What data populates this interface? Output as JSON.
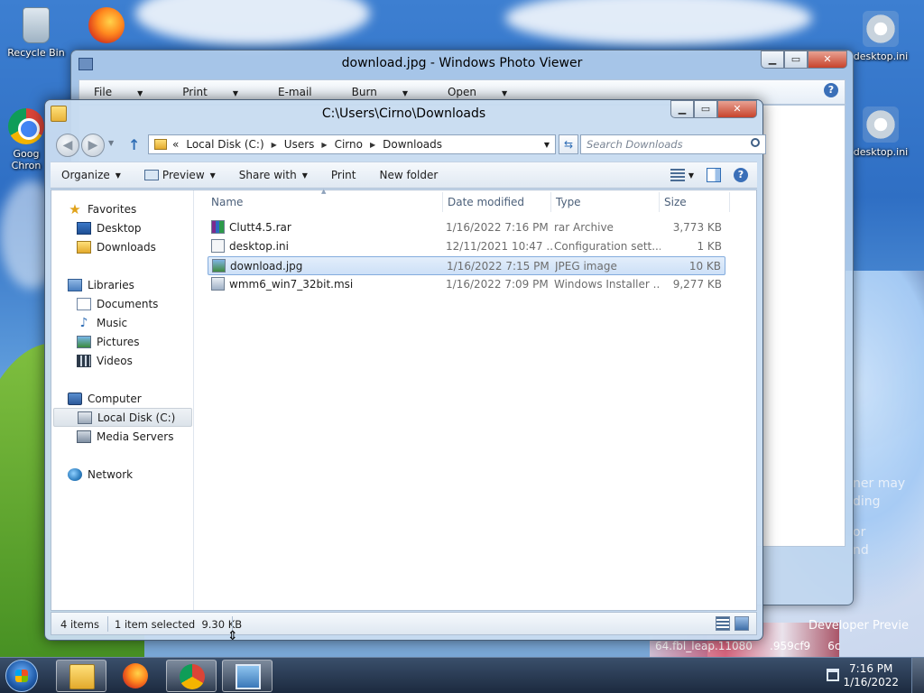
{
  "desktop": {
    "icons": {
      "recycle_bin": "Recycle Bin",
      "chrome_line1": "Goog",
      "chrome_line2": "Chron",
      "desktop_ini_1": "desktop.ini",
      "desktop_ini_2": "desktop.ini"
    },
    "watermark": {
      "line1": "ner may",
      "line2": "ding",
      "line3": "or",
      "line4": "nd",
      "build_name": "Developer Previe",
      "build_string": "64.fbl_leap.11080     .959cf9     6c"
    }
  },
  "photo_viewer": {
    "title": "download.jpg - Windows Photo Viewer",
    "menu": [
      "File",
      "Print",
      "E-mail",
      "Burn",
      "Open"
    ],
    "help": "?"
  },
  "explorer": {
    "title": "C:\\Users\\Cirno\\Downloads",
    "window_buttons": {
      "min": "▁",
      "max": "▭",
      "close": "✕"
    },
    "address": {
      "prefix": "«",
      "crumbs": [
        "Local Disk (C:)",
        "Users",
        "Cirno",
        "Downloads"
      ]
    },
    "search_placeholder": "Search Downloads",
    "toolbar": {
      "organize": "Organize",
      "preview": "Preview",
      "share": "Share with",
      "print": "Print",
      "new_folder": "New folder",
      "help": "?"
    },
    "nav": {
      "favorites": "Favorites",
      "desktop": "Desktop",
      "downloads": "Downloads",
      "libraries": "Libraries",
      "documents": "Documents",
      "music": "Music",
      "pictures": "Pictures",
      "videos": "Videos",
      "computer": "Computer",
      "local_disk": "Local Disk (C:)",
      "media_servers": "Media Servers",
      "network": "Network"
    },
    "columns": {
      "name": "Name",
      "date": "Date modified",
      "type": "Type",
      "size": "Size"
    },
    "files": [
      {
        "name": "Clutt4.5.rar",
        "date": "1/16/2022 7:16 PM",
        "type": "rar Archive",
        "size": "3,773 KB",
        "icon": "rar-icon"
      },
      {
        "name": "desktop.ini",
        "date": "12/11/2021 10:47 ...",
        "type": "Configuration sett...",
        "size": "1 KB",
        "icon": "ini-icon"
      },
      {
        "name": "download.jpg",
        "date": "1/16/2022 7:15 PM",
        "type": "JPEG image",
        "size": "10 KB",
        "icon": "jpg-icon",
        "selected": true
      },
      {
        "name": "wmm6_win7_32bit.msi",
        "date": "1/16/2022 7:09 PM",
        "type": "Windows Installer ...",
        "size": "9,277 KB",
        "icon": "msi-icon"
      }
    ],
    "status": {
      "count": "4 items",
      "selection": "1 item selected  9.30 KB"
    }
  },
  "taskbar": {
    "time": "7:16 PM",
    "date": "1/16/2022"
  }
}
